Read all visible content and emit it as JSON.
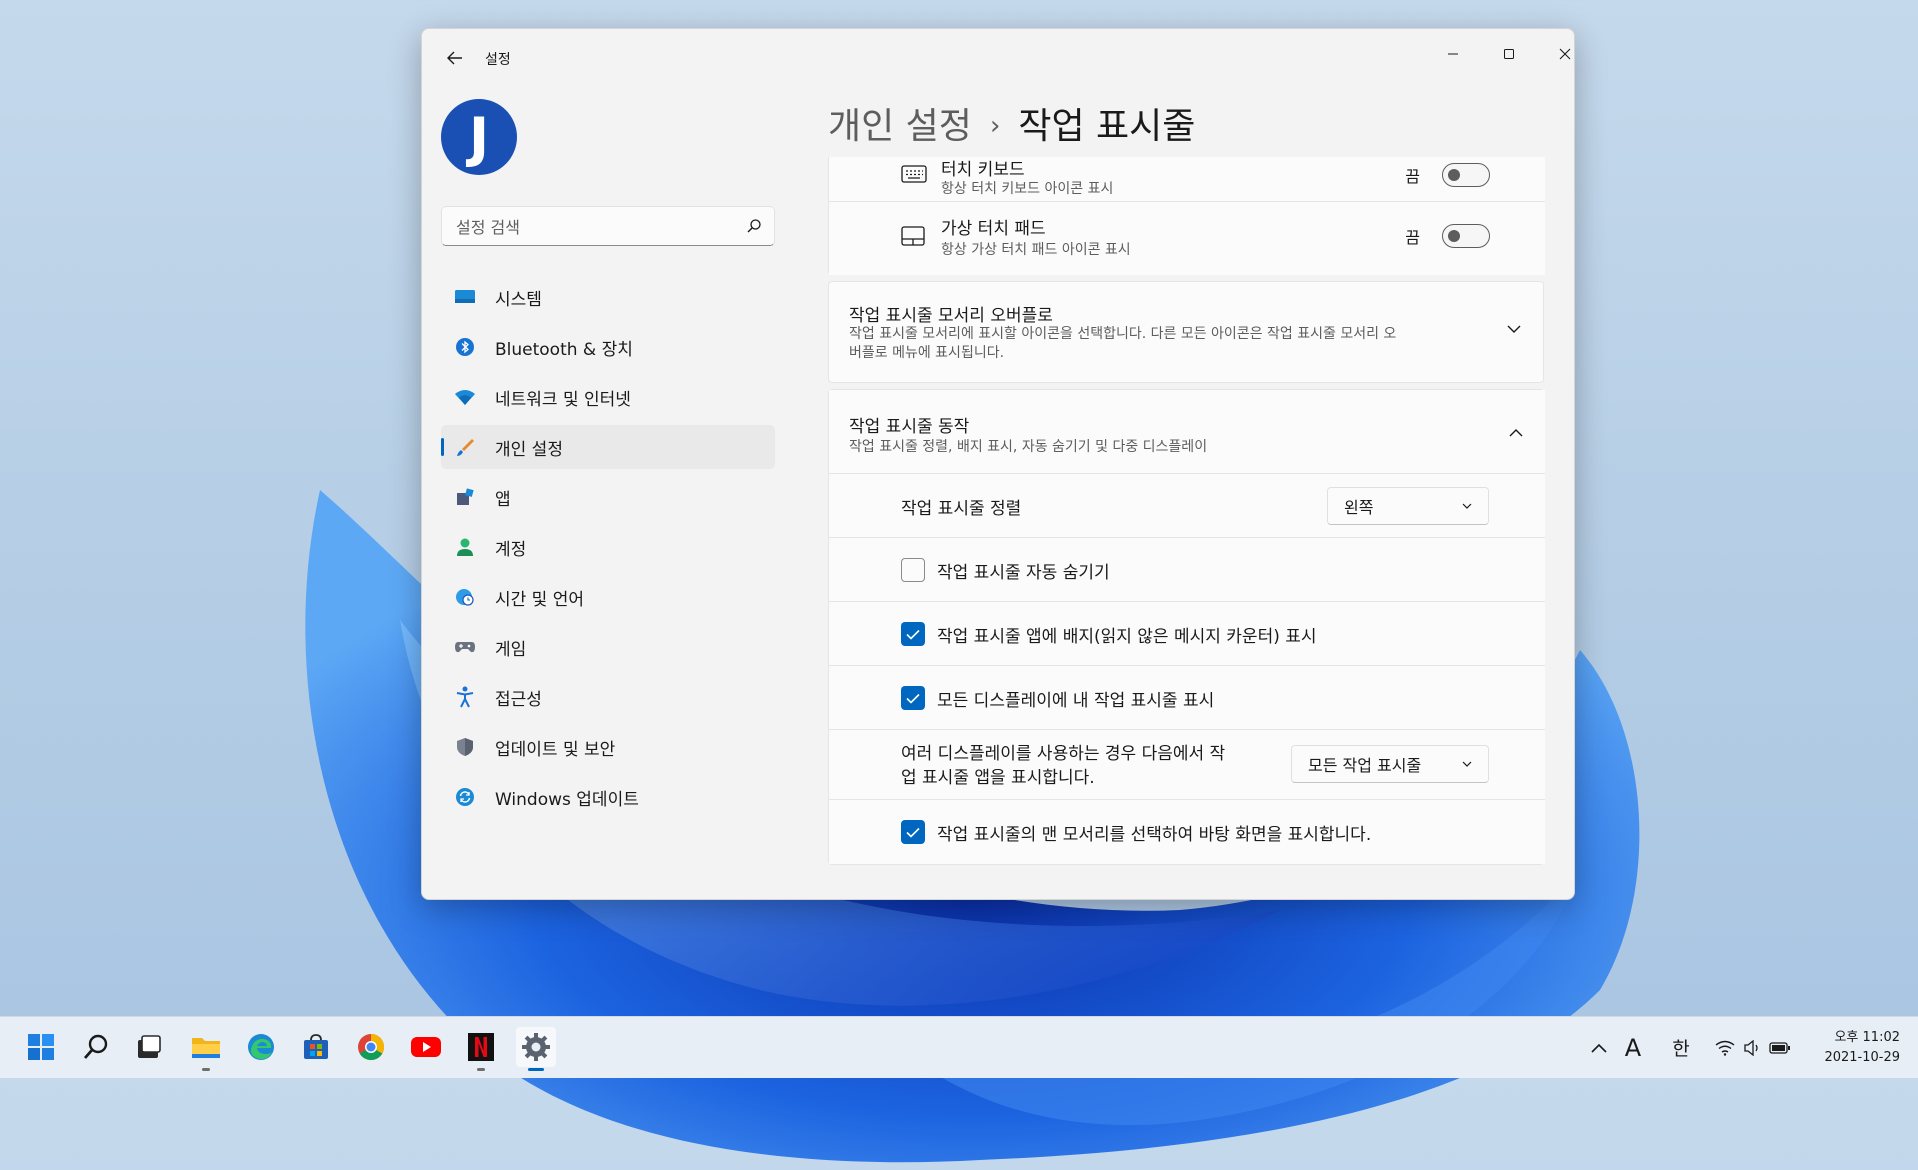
{
  "window": {
    "app_title": "설정",
    "avatar_initial": "J",
    "search_placeholder": "설정 검색"
  },
  "breadcrumb": {
    "parent": "개인 설정",
    "separator": "›",
    "current": "작업 표시줄"
  },
  "sidebar": {
    "items": [
      {
        "label": "시스템",
        "icon": "system-icon"
      },
      {
        "label": "Bluetooth & 장치",
        "icon": "bluetooth-icon"
      },
      {
        "label": "네트워크 및 인터넷",
        "icon": "wifi-icon"
      },
      {
        "label": "개인 설정",
        "icon": "brush-icon",
        "active": true
      },
      {
        "label": "앱",
        "icon": "apps-icon"
      },
      {
        "label": "계정",
        "icon": "person-icon"
      },
      {
        "label": "시간 및 언어",
        "icon": "globe-clock-icon"
      },
      {
        "label": "게임",
        "icon": "gamepad-icon"
      },
      {
        "label": "접근성",
        "icon": "accessibility-icon"
      },
      {
        "label": "업데이트 및 보안",
        "icon": "shield-icon"
      },
      {
        "label": "Windows 업데이트",
        "icon": "sync-icon"
      }
    ]
  },
  "content": {
    "touch_keyboard": {
      "title": "터치 키보드",
      "subtitle": "항상 터치 키보드 아이콘 표시",
      "state": "끔"
    },
    "touchpad": {
      "title": "가상 터치 패드",
      "subtitle": "항상 가상 터치 패드 아이콘 표시",
      "state": "끔"
    },
    "overflow": {
      "title": "작업 표시줄 모서리 오버플로",
      "subtitle_line1": "작업 표시줄 모서리에 표시할 아이콘을 선택합니다. 다른 모든 아이콘은 작업 표시줄 모서리 오",
      "subtitle_line2": "버플로 메뉴에 표시됩니다."
    },
    "behaviors": {
      "title": "작업 표시줄 동작",
      "subtitle": "작업 표시줄 정렬, 배지 표시, 자동 숨기기 및 다중 디스플레이",
      "alignment_label": "작업 표시줄 정렬",
      "alignment_value": "왼쪽",
      "autohide_label": "작업 표시줄 자동 숨기기",
      "autohide_checked": false,
      "badges_label": "작업 표시줄 앱에 배지(읽지 않은 메시지 카운터) 표시",
      "badges_checked": true,
      "all_displays_label": "모든 디스플레이에 내 작업 표시줄 표시",
      "all_displays_checked": true,
      "multi_display_label_line1": "여러 디스플레이를 사용하는 경우 다음에서 작",
      "multi_display_label_line2": "업 표시줄 앱을 표시합니다.",
      "multi_display_value": "모든 작업 표시줄",
      "far_corner_label": "작업 표시줄의 맨 모서리를 선택하여 바탕 화면을 표시합니다.",
      "far_corner_checked": true
    }
  },
  "taskbar": {
    "apps": [
      "start-icon",
      "search-icon",
      "task-view-icon",
      "file-explorer-icon",
      "edge-icon",
      "store-icon",
      "chrome-icon",
      "youtube-icon",
      "netflix-icon",
      "settings-icon"
    ],
    "tray": {
      "chevron": "^",
      "font_indicator": "A",
      "ime": "한",
      "time_line1": "오후 11:02",
      "time_line2": "2021-10-29"
    }
  },
  "colors": {
    "accent": "#0067c0",
    "avatar": "#1a4fb4",
    "window_bg": "#f3f3f3",
    "card_bg": "#fbfbfb"
  }
}
